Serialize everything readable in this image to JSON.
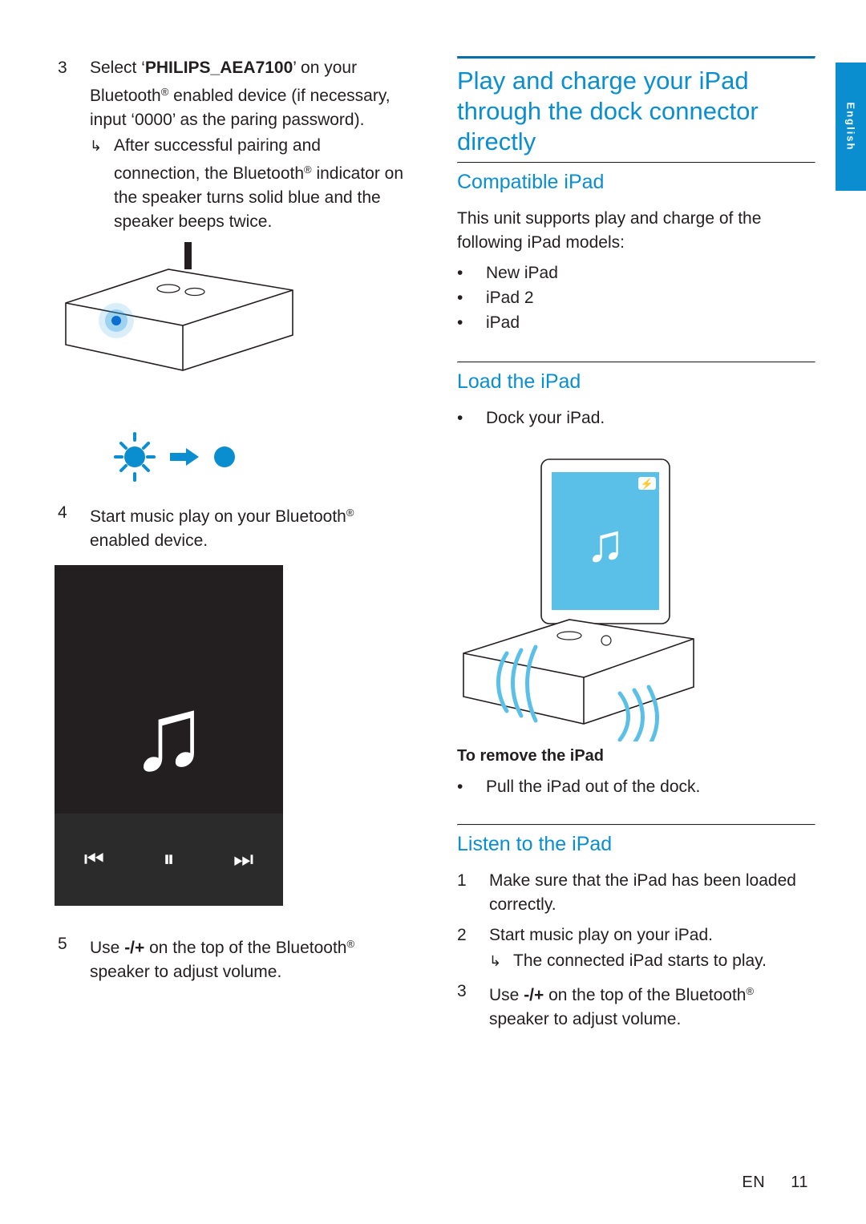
{
  "document": {
    "language_tab": "English",
    "footer": {
      "lang_code": "EN",
      "page_number": "11"
    },
    "accent_color": "#0a8ed0",
    "rule_color": "#0a6fa8"
  },
  "left_column": {
    "steps": [
      {
        "number": "3",
        "text_before": "Select ‘",
        "bold": "PHILIPS_AEA7100",
        "text_after": "’ on your Bluetooth",
        "text_after2": " enabled device (if necessary, input ‘0000’ as the paring password).",
        "sub_arrow": "↳",
        "sub_text": "After successful pairing and connection, the Bluetooth",
        "sub_text2": " indicator on the speaker turns solid blue and the speaker beeps twice."
      },
      {
        "number": "4",
        "text": "Start music play on your Bluetooth",
        "text2": " enabled device."
      },
      {
        "number": "5",
        "text_before": "Use ",
        "bold": "-/+",
        "text_after": " on the top of the Bluetooth",
        "text_after2": " speaker to adjust volume."
      }
    ],
    "figures": {
      "speaker": "speaker-illustration",
      "led_blink": "blinking-blue-led-to-solid-led",
      "phone": {
        "name": "phone-music-player-illustration",
        "note_glyph": "♫",
        "controls": [
          "previous-track",
          "pause",
          "next-track"
        ]
      }
    }
  },
  "right_column": {
    "title": "Play and charge your iPad through the dock connector directly",
    "sections": [
      {
        "heading": "Compatible iPad",
        "paragraph": "This unit supports play and charge of the following iPad models:",
        "bullets": [
          "New iPad",
          "iPad 2",
          "iPad"
        ]
      },
      {
        "heading": "Load the iPad",
        "bullets": [
          "Dock your iPad."
        ],
        "figure": "ipad-docked-on-speaker-illustration",
        "subhead": "To remove the iPad",
        "bullets2": [
          "Pull the iPad out of the dock."
        ]
      },
      {
        "heading": "Listen to the iPad",
        "steps": [
          {
            "number": "1",
            "text": "Make sure that the iPad has been loaded correctly."
          },
          {
            "number": "2",
            "text": "Start music play on your iPad.",
            "sub_arrow": "↳",
            "sub_text": "The connected iPad starts to play."
          },
          {
            "number": "3",
            "text_before": "Use ",
            "bold": "-/+",
            "text_after": " on the top of the Bluetooth",
            "text_after2": " speaker to adjust volume."
          }
        ]
      }
    ]
  }
}
